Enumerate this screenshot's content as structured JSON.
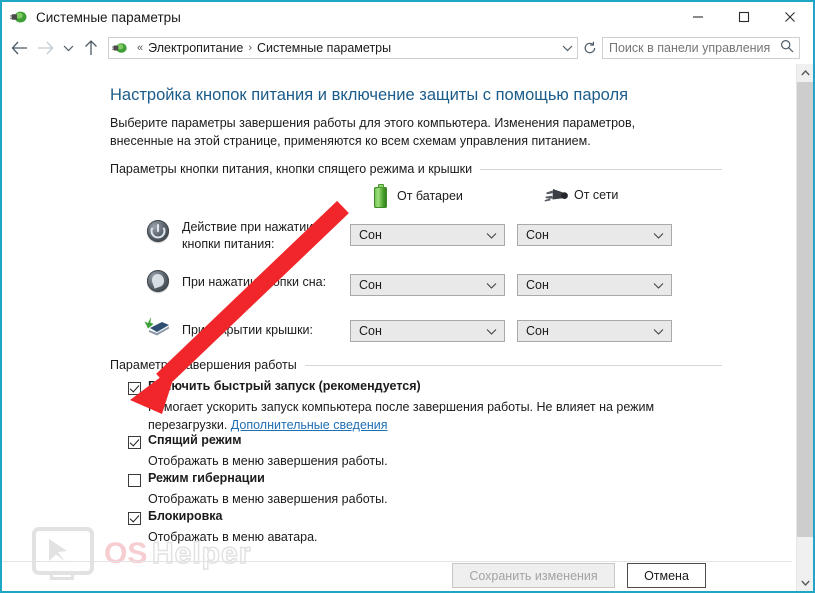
{
  "window": {
    "title": "Системные параметры",
    "icon": "power-options-icon",
    "border_color": "#1ea7c4",
    "controls": {
      "minimize": "minimize-icon",
      "maximize": "maximize-icon",
      "close": "close-icon"
    }
  },
  "navbar": {
    "back": "back-arrow-icon",
    "forward": "forward-arrow-icon",
    "recent": "chevron-down-icon",
    "up": "up-arrow-icon",
    "breadcrumb": {
      "overflow": "«",
      "items": [
        "Электропитание",
        "Системные параметры"
      ],
      "separator": "›"
    },
    "refresh": "refresh-icon",
    "search": {
      "placeholder": "Поиск в панели управления",
      "value": "",
      "icon": "search-icon"
    }
  },
  "page": {
    "title": "Настройка кнопок питания и включение защиты с помощью пароля",
    "description": "Выберите параметры завершения работы для этого компьютера. Изменения параметров, внесенные на этой странице, применяются ко всем схемам управления питанием."
  },
  "groups": {
    "buttons_group_title": "Параметры кнопки питания, кнопки спящего режима и крышки",
    "shutdown_group_title": "Параметры завершения работы"
  },
  "columns": [
    {
      "label": "От батареи",
      "icon": "battery-icon"
    },
    {
      "label": "От сети",
      "icon": "power-plug-icon"
    }
  ],
  "settings": [
    {
      "icon": "power-button-icon",
      "label": "Действие при нажатии кнопки питания:",
      "battery_value": "Сон",
      "ac_value": "Сон"
    },
    {
      "icon": "sleep-button-icon",
      "label": "При нажатии кнопки сна:",
      "battery_value": "Сон",
      "ac_value": "Сон"
    },
    {
      "icon": "laptop-lid-icon",
      "label": "При закрытии крышки:",
      "battery_value": "Сон",
      "ac_value": "Сон"
    }
  ],
  "checkboxes": [
    {
      "label": "Включить быстрый запуск (рекомендуется)",
      "checked": true,
      "description_part1": "Помогает ускорить запуск компьютера после завершения работы. Не влияет на режим перезагрузки. ",
      "link": "Дополнительные сведения"
    },
    {
      "label": "Спящий режим",
      "checked": true,
      "description_part1": "Отображать в меню завершения работы.",
      "link": ""
    },
    {
      "label": "Режим гибернации",
      "checked": false,
      "description_part1": "Отображать в меню завершения работы.",
      "link": ""
    },
    {
      "label": "Блокировка",
      "checked": true,
      "description_part1": "Отображать в меню аватара.",
      "link": ""
    }
  ],
  "footer": {
    "save_label": "Сохранить изменения",
    "save_enabled": false,
    "cancel_label": "Отмена"
  },
  "watermark": {
    "text_primary": "OS",
    "text_secondary": "Helper",
    "primary_color": "#f6cdd0",
    "outline_color": "#e2e2e2"
  },
  "annotation": {
    "arrow_color": "#f0262a",
    "points_to": "fast-startup-checkbox"
  },
  "scrollbar": {
    "up_arrow": "scroll-up-icon",
    "down_arrow": "scroll-down-icon"
  }
}
